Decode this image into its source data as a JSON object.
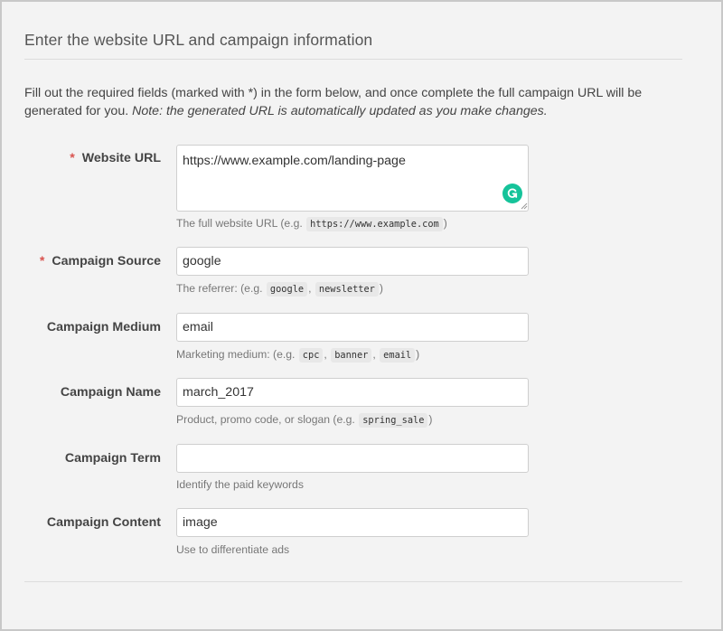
{
  "heading": "Enter the website URL and campaign information",
  "intro": {
    "text": "Fill out the required fields (marked with *) in the form below, and once complete the full campaign URL will be generated for you.",
    "note": "Note: the generated URL is automatically updated as you make changes."
  },
  "required_marker": "*",
  "fields": {
    "website_url": {
      "label": "Website URL",
      "value": "https://www.example.com/landing-page",
      "help_prefix": "The full website URL (e.g.",
      "help_codes": [
        "https://www.example.com"
      ],
      "help_suffix": ")"
    },
    "campaign_source": {
      "label": "Campaign Source",
      "value": "google",
      "help_prefix": "The referrer: (e.g.",
      "help_codes": [
        "google",
        "newsletter"
      ],
      "help_suffix": ")"
    },
    "campaign_medium": {
      "label": "Campaign Medium",
      "value": "email",
      "help_prefix": "Marketing medium: (e.g.",
      "help_codes": [
        "cpc",
        "banner",
        "email"
      ],
      "help_suffix": ")"
    },
    "campaign_name": {
      "label": "Campaign Name",
      "value": "march_2017",
      "help_prefix": "Product, promo code, or slogan (e.g.",
      "help_codes": [
        "spring_sale"
      ],
      "help_suffix": ")"
    },
    "campaign_term": {
      "label": "Campaign Term",
      "value": "",
      "help": "Identify the paid keywords"
    },
    "campaign_content": {
      "label": "Campaign Content",
      "value": "image",
      "help": "Use to differentiate ads"
    }
  },
  "icons": {
    "grammarly": "grammarly-icon",
    "resize": "resize-handle-icon"
  },
  "colors": {
    "required": "#d9534f",
    "grammarly": "#15c39a",
    "background": "#f3f3f3"
  }
}
